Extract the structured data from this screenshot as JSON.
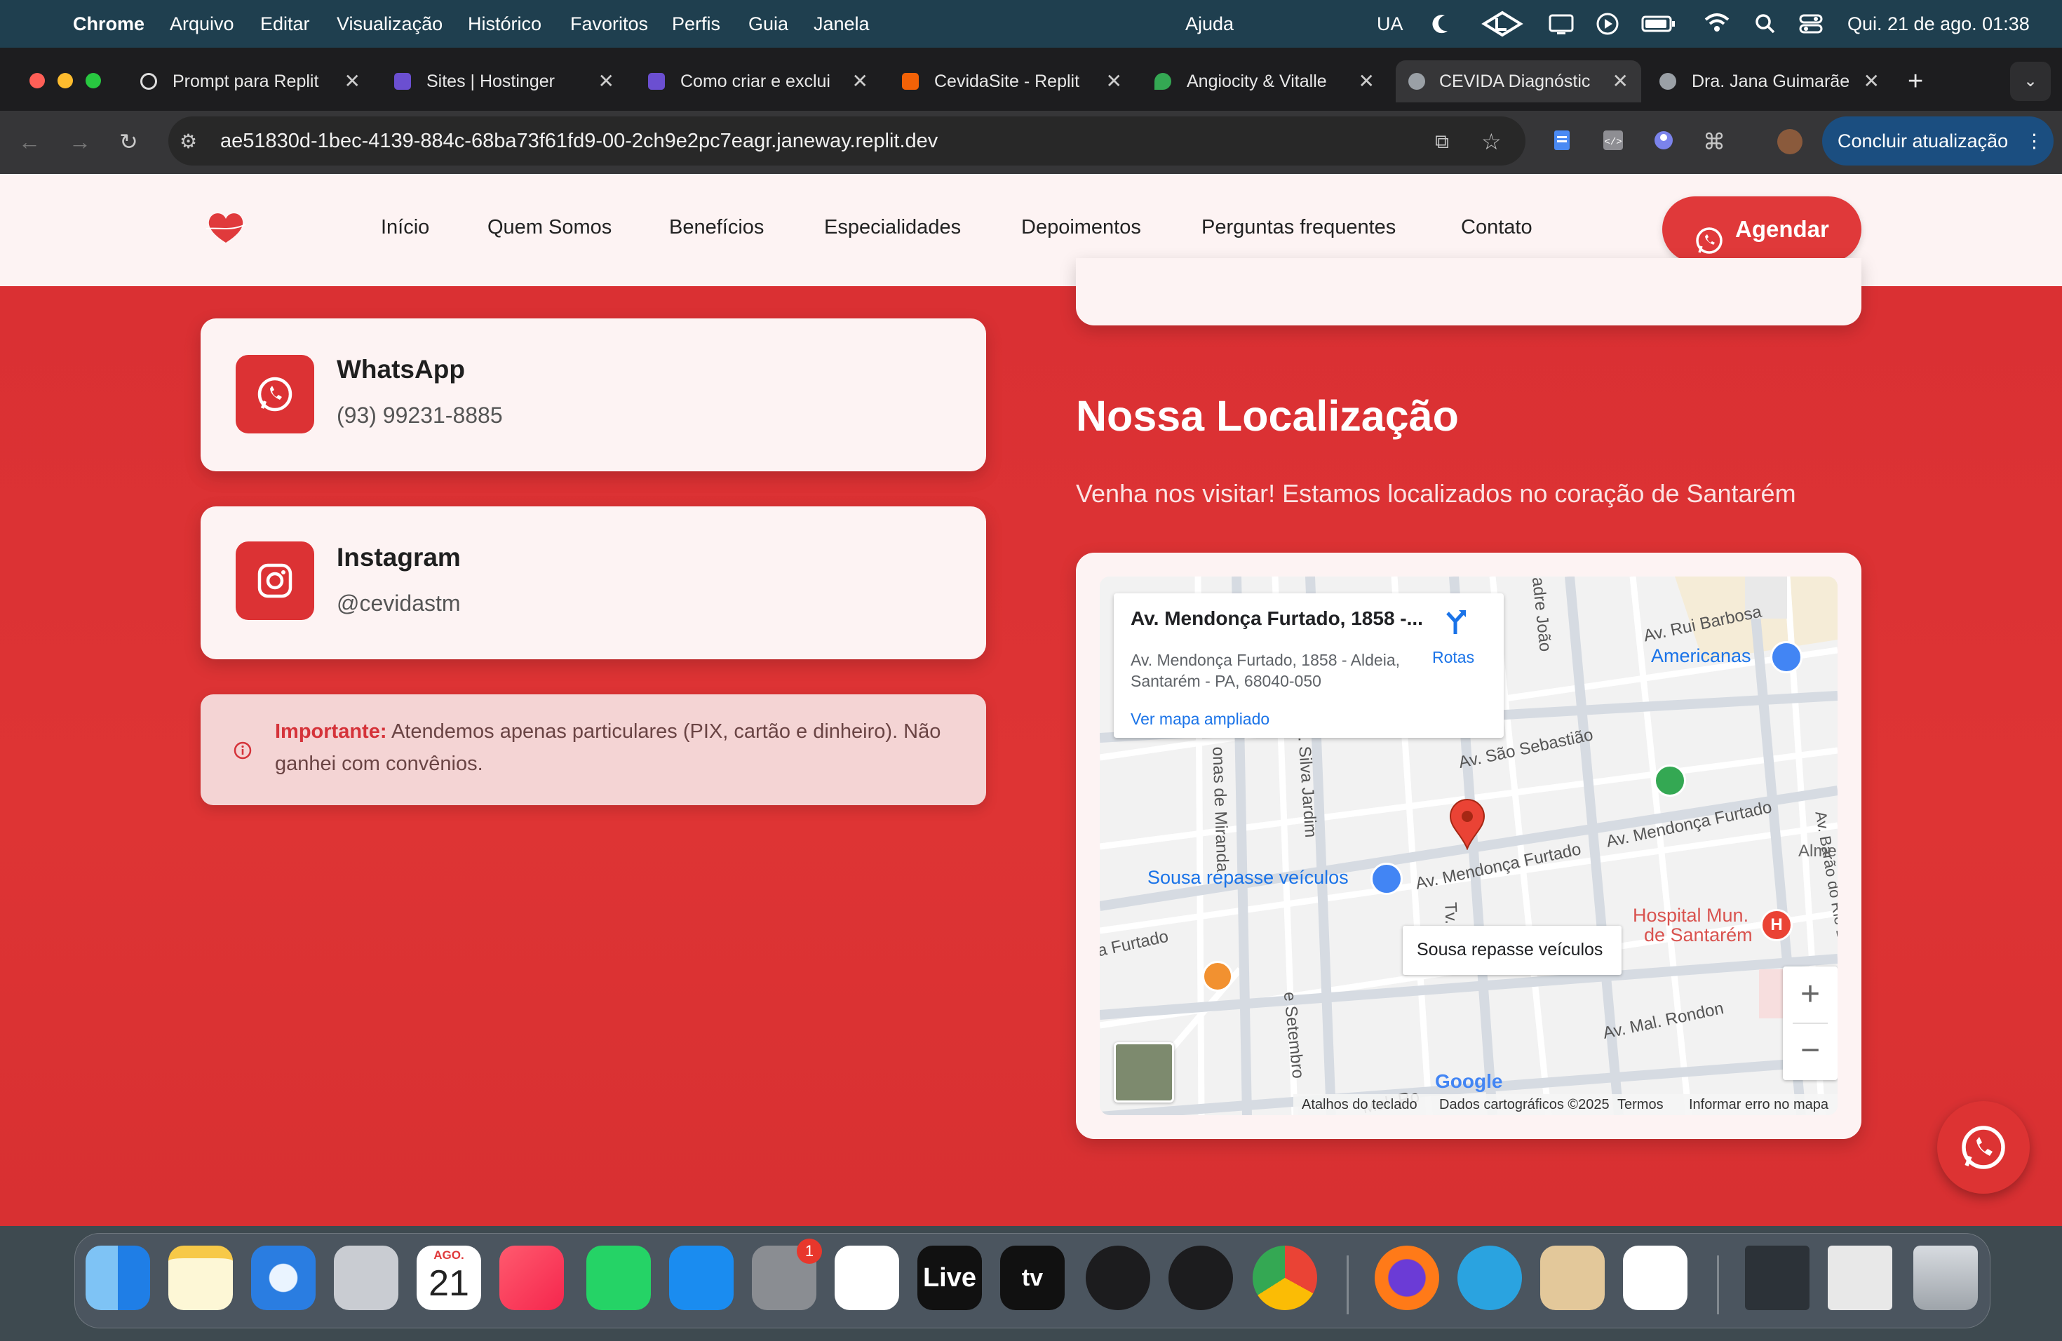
{
  "menubar": {
    "app": "Chrome",
    "menus": [
      "Arquivo",
      "Editar",
      "Visualização",
      "Histórico",
      "Favoritos",
      "Perfis",
      "Guia",
      "Janela"
    ],
    "help": "Ajuda",
    "input_source": "UA",
    "datetime": "Qui. 21 de ago.  01:38"
  },
  "tabs": [
    {
      "label": "Prompt para Replit",
      "color": "#cfcfcf"
    },
    {
      "label": "Sites | Hostinger",
      "color": "#6b4fd1"
    },
    {
      "label": "Como criar e exclui",
      "color": "#6b4fd1"
    },
    {
      "label": "CevidaSite - Replit",
      "color": "#f26207"
    },
    {
      "label": "Angiocity & Vitalle",
      "color": "#34a853"
    },
    {
      "label": "CEVIDA Diagnóstic",
      "color": "#9aa0a6"
    },
    {
      "label": "Dra. Jana Guimarãe",
      "color": "#9aa0a6"
    }
  ],
  "address": {
    "url": "ae51830d-1bec-4139-884c-68ba73f61fd9-00-2ch9e2pc7eagr.janeway.replit.dev"
  },
  "update_button": "Concluir atualização",
  "nav": {
    "links": [
      "Início",
      "Quem Somos",
      "Benefícios",
      "Especialidades",
      "Depoimentos",
      "Perguntas frequentes",
      "Contato"
    ],
    "cta": "Agendar"
  },
  "contacts": {
    "whatsapp": {
      "title": "WhatsApp",
      "value": "(93) 99231-8885"
    },
    "instagram": {
      "title": "Instagram",
      "value": "@cevidastm"
    }
  },
  "notice": {
    "label": "Importante:",
    "text": " Atendemos apenas particulares (PIX, cartão e dinheiro). Não ganhei com convênios."
  },
  "location": {
    "heading": "Nossa Localização",
    "subtitle": "Venha nos visitar! Estamos localizados no coração de Santarém"
  },
  "map": {
    "place_title": "Av. Mendonça Furtado, 1858 -...",
    "address_line1": "Av. Mendonça Furtado, 1858 - Aldeia,",
    "address_line2": "Santarém - PA, 68040-050",
    "directions": "Rotas",
    "larger_map": "Ver mapa ampliado",
    "streets": {
      "rui_barbosa": "Av. Rui Barbosa",
      "sao_sebastiao": "Av. São Sebastião",
      "mendonca_1": "Av. Mendonça Furtado",
      "mendonca_2": "Av. Mendonça Furtado",
      "furtado_left": "a Furtado",
      "miranda": "onas de Miranda",
      "silva_jardim": "Tv. Silva Jardim",
      "setembro": "e Setembro",
      "mal_rondon": "Av. Mal. Rondon",
      "mal_rondon_2": "Mal. Ro",
      "barao": "Av. Barão do Rio Branco",
      "padre_joao": "adre João",
      "alme": "Alme",
      "tv": "Tv."
    },
    "pois": {
      "americanas": "Americanas",
      "sousa": "Sousa repasse veículos",
      "hospital_1": "Hospital Mun.",
      "hospital_2": "de Santarém"
    },
    "tooltip": "Sousa repasse veículos",
    "footer": {
      "shortcuts": "Atalhos do teclado",
      "data": "Dados cartográficos ©2025",
      "terms": "Termos",
      "report": "Informar erro no mapa"
    },
    "google": "Google"
  },
  "dock": {
    "calendar_month": "AGO.",
    "calendar_day": "21",
    "settings_badge": "1",
    "live_label": "Live",
    "tv_label": "tv"
  }
}
